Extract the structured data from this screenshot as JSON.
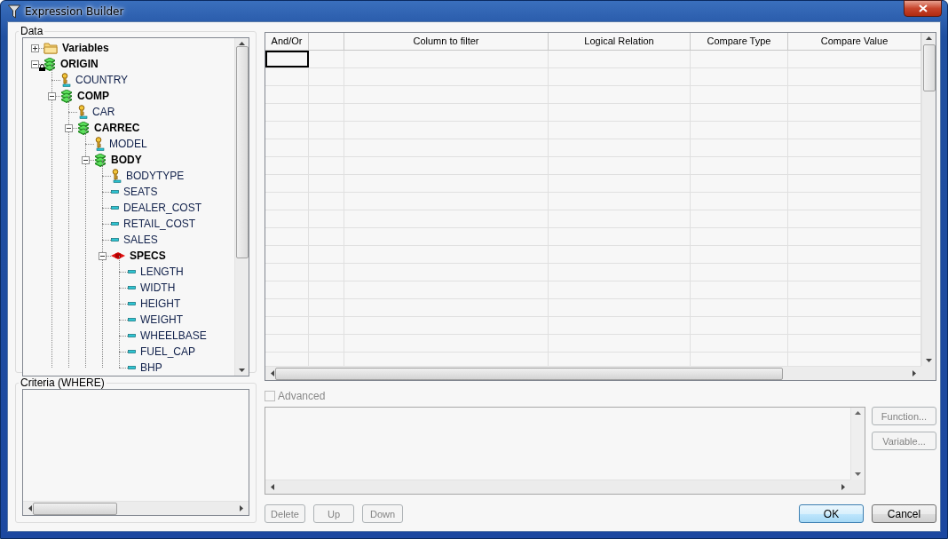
{
  "window": {
    "title": "Expression Builder"
  },
  "data_panel": {
    "label": "Data",
    "tree": [
      {
        "label": "Variables",
        "kind": "folder",
        "expanded": false
      },
      {
        "label": "ORIGIN",
        "kind": "segment",
        "expanded": true,
        "locked": true,
        "children": [
          {
            "label": "COUNTRY",
            "kind": "key"
          },
          {
            "label": "COMP",
            "kind": "segment",
            "expanded": true,
            "children": [
              {
                "label": "CAR",
                "kind": "key"
              },
              {
                "label": "CARREC",
                "kind": "segment",
                "expanded": true,
                "children": [
                  {
                    "label": "MODEL",
                    "kind": "key"
                  },
                  {
                    "label": "BODY",
                    "kind": "segment",
                    "expanded": true,
                    "children": [
                      {
                        "label": "BODYTYPE",
                        "kind": "key"
                      },
                      {
                        "label": "SEATS",
                        "kind": "field"
                      },
                      {
                        "label": "DEALER_COST",
                        "kind": "field"
                      },
                      {
                        "label": "RETAIL_COST",
                        "kind": "field"
                      },
                      {
                        "label": "SALES",
                        "kind": "field"
                      },
                      {
                        "label": "SPECS",
                        "kind": "special",
                        "expanded": true,
                        "children": [
                          {
                            "label": "LENGTH",
                            "kind": "field"
                          },
                          {
                            "label": "WIDTH",
                            "kind": "field"
                          },
                          {
                            "label": "HEIGHT",
                            "kind": "field"
                          },
                          {
                            "label": "WEIGHT",
                            "kind": "field"
                          },
                          {
                            "label": "WHEELBASE",
                            "kind": "field"
                          },
                          {
                            "label": "FUEL_CAP",
                            "kind": "field"
                          },
                          {
                            "label": "BHP",
                            "kind": "field"
                          }
                        ]
                      }
                    ]
                  }
                ]
              }
            ]
          }
        ]
      }
    ]
  },
  "grid": {
    "columns": [
      {
        "label": "And/Or"
      },
      {},
      {
        "label": "Column to filter"
      },
      {
        "label": "Logical Relation"
      },
      {
        "label": "Compare Type"
      },
      {
        "label": "Compare Value"
      }
    ],
    "rows": [
      {
        "selected": true
      },
      {
        "selected": false
      },
      {
        "selected": false
      },
      {
        "selected": false
      },
      {
        "selected": false
      },
      {
        "selected": false
      },
      {
        "selected": false
      },
      {
        "selected": false
      },
      {
        "selected": false
      },
      {
        "selected": false
      },
      {
        "selected": false
      },
      {
        "selected": false
      },
      {
        "selected": false
      },
      {
        "selected": false
      },
      {
        "selected": false
      },
      {
        "selected": false
      },
      {
        "selected": false
      },
      {
        "selected": false
      }
    ]
  },
  "criteria_panel": {
    "label": "Criteria (WHERE)"
  },
  "advanced": {
    "label": "Advanced",
    "checked": false,
    "disabled": true
  },
  "side_buttons": [
    {
      "label": "Function...",
      "disabled": true
    },
    {
      "label": "Variable...",
      "disabled": true
    }
  ],
  "row_buttons": [
    {
      "label": "Delete",
      "disabled": true
    },
    {
      "label": "Up",
      "disabled": true
    },
    {
      "label": "Down",
      "disabled": true
    }
  ],
  "dialog_buttons": [
    {
      "label": "OK",
      "default": true
    },
    {
      "label": "Cancel",
      "default": false
    }
  ]
}
